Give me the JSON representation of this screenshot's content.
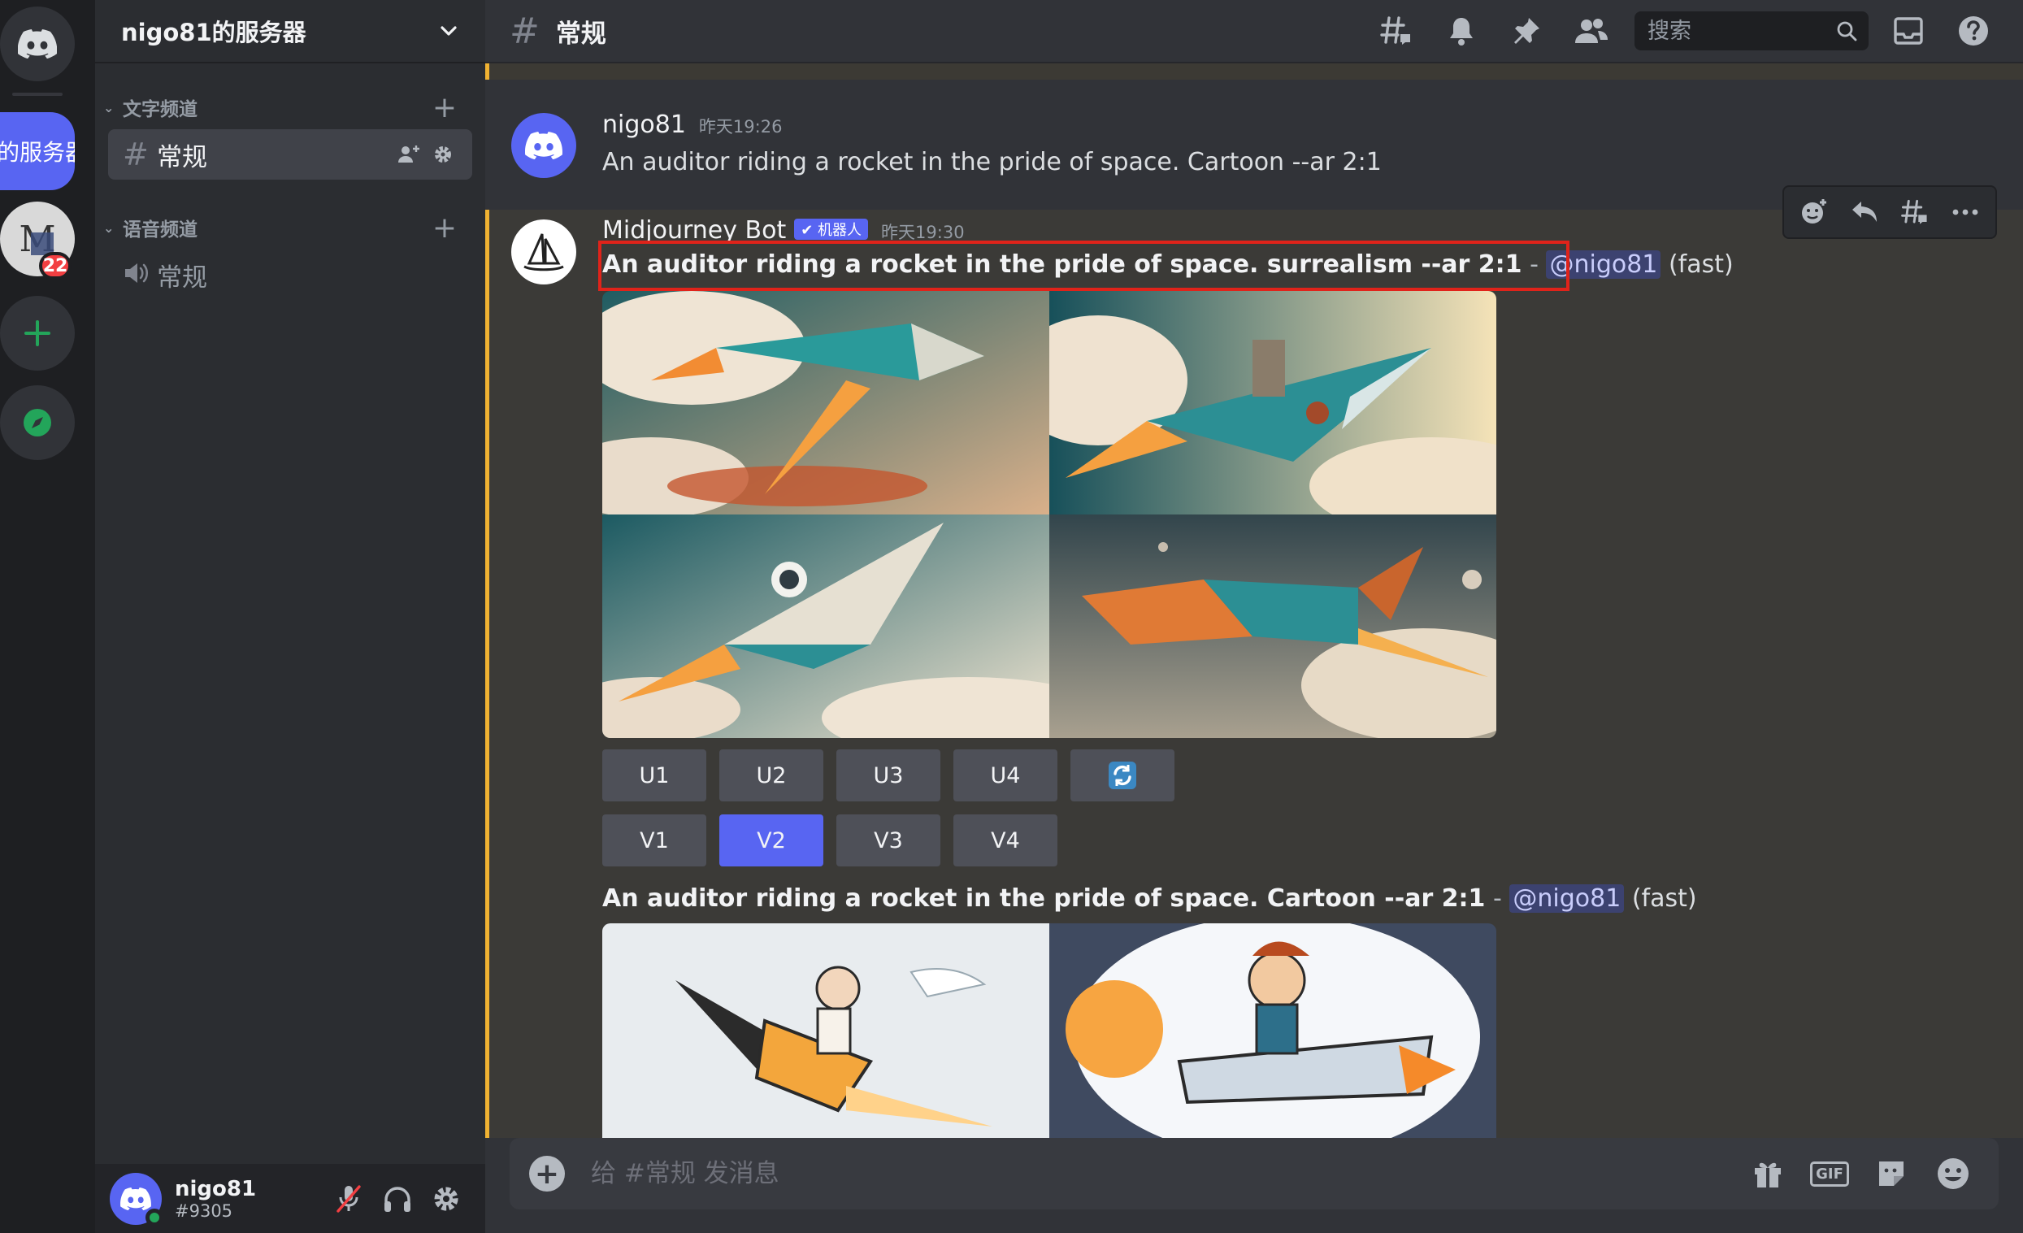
{
  "server": {
    "name": "nigo81的服务器",
    "rail_current_label": "的服务器",
    "rail_m_glyph": "M",
    "rail_badge": "22"
  },
  "categories": [
    {
      "label": "文字频道"
    },
    {
      "label": "语音频道"
    }
  ],
  "channels": {
    "text_channel": "常规",
    "voice_channel": "常规"
  },
  "user": {
    "name": "nigo81",
    "tag": "#9305"
  },
  "topbar": {
    "channel": "常规",
    "search_placeholder": "搜索"
  },
  "messages": [
    {
      "author": "nigo81",
      "time": "昨天19:26",
      "text": "An auditor riding a rocket in the pride of space. Cartoon --ar 2:1"
    },
    {
      "author": "Midjourney Bot",
      "badge": "✔ 机器人",
      "time": "昨天19:30",
      "prompt": "An auditor riding a rocket in the pride of space. surrealism --ar 2:1",
      "separator": "-",
      "mention": "@nigo81",
      "speed": "(fast)",
      "buttons_upscale": [
        "U1",
        "U2",
        "U3",
        "U4"
      ],
      "buttons_variation": [
        "V1",
        "V2",
        "V3",
        "V4"
      ],
      "selected_button": "V2"
    },
    {
      "prompt": "An auditor riding a rocket in the pride of space. Cartoon --ar 2:1",
      "separator": "-",
      "mention": "@nigo81",
      "speed": "(fast)"
    }
  ],
  "composer": {
    "placeholder": "给 #常规 发消息",
    "gif_label": "GIF"
  },
  "colors": {
    "blurple": "#5865f2",
    "highlight_bar": "#f0b232",
    "annotation_box": "#e0231a",
    "online": "#23a55a",
    "badge_red": "#f23f42"
  }
}
